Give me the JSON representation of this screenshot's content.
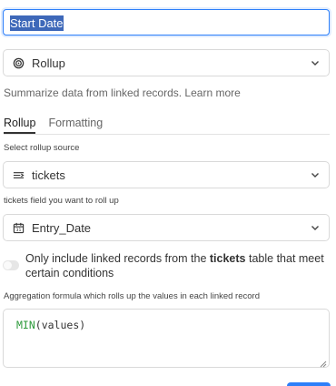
{
  "field_name": {
    "value": "Start Date"
  },
  "field_type": {
    "icon": "rollup-icon",
    "label": "Rollup"
  },
  "description": {
    "text": "Summarize data from linked records.",
    "learn_more": "Learn more"
  },
  "tabs": [
    {
      "label": "Rollup",
      "active": true
    },
    {
      "label": "Formatting",
      "active": false
    }
  ],
  "source": {
    "label": "Select rollup source",
    "icon": "linked-field-icon",
    "value": "tickets"
  },
  "rollup_field": {
    "label": "tickets field you want to roll up",
    "icon": "date-icon",
    "value": "Entry_Date"
  },
  "condition": {
    "prefix": "Only include linked records from the",
    "table": "tickets",
    "suffix": "table that meet certain conditions",
    "enabled": false
  },
  "formula": {
    "label": "Aggregation formula which rolls up the values in each linked record",
    "fn": "MIN",
    "args": "(values)"
  },
  "colors": {
    "accent": "#2d7ff9",
    "formula_fn": "#2c9a3a",
    "selection": "#3e68b9"
  }
}
